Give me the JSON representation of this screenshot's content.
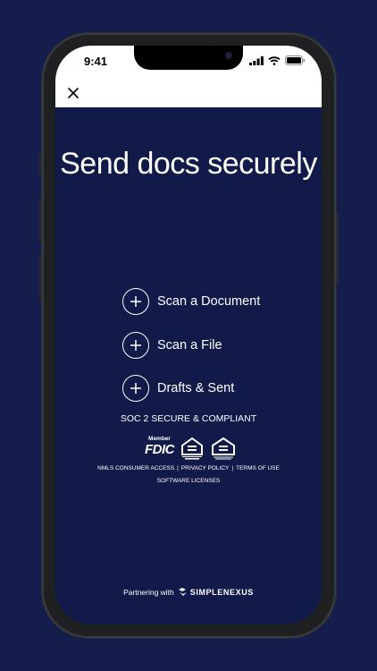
{
  "status": {
    "time": "9:41"
  },
  "header": {
    "close_icon": "close-icon"
  },
  "main": {
    "title": "Send docs securely",
    "actions": [
      {
        "label": "Scan a Document",
        "icon": "plus-icon"
      },
      {
        "label": "Scan a File",
        "icon": "plus-icon"
      },
      {
        "label": "Drafts & Sent",
        "icon": "plus-icon"
      }
    ]
  },
  "footer": {
    "compliance": "SOC 2 SECURE & COMPLIANT",
    "fdic_member": "Member",
    "fdic_word": "FDIC",
    "links": [
      "NMLS CONSUMER ACCESS",
      "PRIVACY POLICY",
      "TERMS OF USE"
    ],
    "link_separator": "|",
    "software_link": "SOFTWARE LICENSES",
    "partner_prefix": "Partnering with",
    "partner_brand": "SIMPLENEXUS"
  },
  "colors": {
    "background": "#141d4c",
    "screen": "#121a4a",
    "header": "#ffffff"
  }
}
